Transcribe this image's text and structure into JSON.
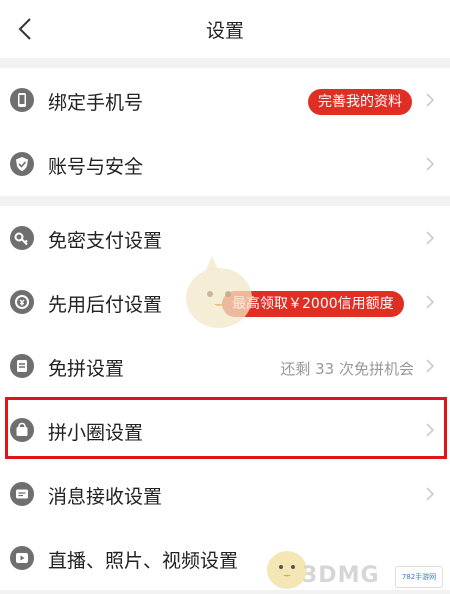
{
  "header": {
    "title": "设置"
  },
  "groups": [
    {
      "rows": [
        {
          "label": "绑定手机号",
          "icon": "phone-icon",
          "badge": "完善我的资料"
        },
        {
          "label": "账号与安全",
          "icon": "shield-icon"
        }
      ]
    },
    {
      "rows": [
        {
          "label": "免密支付设置",
          "icon": "key-icon"
        },
        {
          "label": "先用后付设置",
          "icon": "pay-later-icon",
          "badge": "最高领取￥2000信用额度"
        },
        {
          "label": "免拼设置",
          "icon": "free-group-icon",
          "hint": "还剩 33 次免拼机会"
        },
        {
          "label": "拼小圈设置",
          "icon": "bag-icon",
          "highlighted": true
        },
        {
          "label": "消息接收设置",
          "icon": "message-icon"
        },
        {
          "label": "直播、照片、视频设置",
          "icon": "play-icon"
        }
      ]
    }
  ],
  "watermark": {
    "text": "3DMG",
    "logo_text": "782手游网"
  },
  "colors": {
    "accent": "#e02e24",
    "highlight_border": "#e0151a",
    "background": "#f2f2f2"
  }
}
